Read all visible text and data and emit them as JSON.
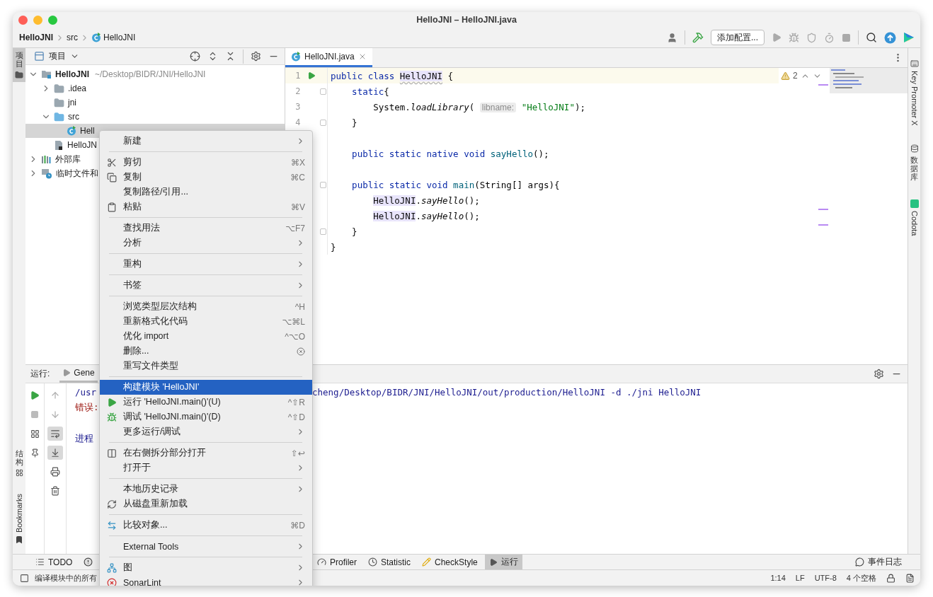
{
  "window": {
    "title": "HelloJNI – HelloJNI.java"
  },
  "breadcrumb": [
    {
      "label": "HelloJNI",
      "kind": "project"
    },
    {
      "label": "src",
      "kind": "folder"
    },
    {
      "label": "HelloJNI",
      "kind": "class"
    }
  ],
  "toolbar": {
    "config_button": "添加配置..."
  },
  "left_stripe": {
    "top": [
      {
        "label": "项目",
        "selected": true
      }
    ],
    "bottom": [
      {
        "label": "结构",
        "kind": "structure",
        "selected": false
      },
      {
        "label": "Bookmarks",
        "kind": "bookmarks",
        "selected": false
      }
    ]
  },
  "project_panel": {
    "title": "项目",
    "tree": [
      {
        "label": "HelloJNI",
        "path": "~/Desktop/BIDR/JNI/HelloJNI",
        "kind": "module",
        "expanded": true,
        "selected": false,
        "children": [
          {
            "label": ".idea",
            "kind": "folder",
            "expanded": false,
            "selected": false
          },
          {
            "label": "jni",
            "kind": "folder",
            "selected": false
          },
          {
            "label": "src",
            "kind": "source-folder",
            "expanded": true,
            "selected": false,
            "children": [
              {
                "label": "Hell",
                "kind": "class",
                "selected": true
              }
            ]
          },
          {
            "label": "HelloJN",
            "kind": "module-file",
            "selected": false
          }
        ]
      },
      {
        "label": "外部库",
        "kind": "library",
        "expanded": false,
        "selected": false
      },
      {
        "label": "临时文件和",
        "kind": "scratch",
        "expanded": false,
        "selected": false
      }
    ]
  },
  "editor": {
    "tabs": [
      {
        "label": "HelloJNI.java",
        "selected": true
      }
    ],
    "warnings": "2",
    "lines": [
      {
        "number": "1",
        "current": true,
        "run_marker": true,
        "fold": false,
        "tokens": [
          {
            "kind": "kw",
            "text": "public class "
          },
          {
            "kind": "ref-decl",
            "text": "HelloJNI"
          },
          {
            "kind": "plain",
            "text": " {"
          }
        ]
      },
      {
        "number": "2",
        "current": false,
        "run_marker": false,
        "fold": true,
        "tokens": [
          {
            "kind": "kw",
            "text": "    static"
          },
          {
            "kind": "plain",
            "text": "{"
          }
        ]
      },
      {
        "number": "3",
        "current": false,
        "run_marker": false,
        "fold": false,
        "tokens": [
          {
            "kind": "plain",
            "text": "        System."
          },
          {
            "kind": "italic",
            "text": "loadLibrary"
          },
          {
            "kind": "plain",
            "text": "( "
          },
          {
            "kind": "hint",
            "text": "libname:"
          },
          {
            "kind": "string",
            "text": " \"HelloJNI\""
          },
          {
            "kind": "plain",
            "text": ");"
          }
        ]
      },
      {
        "number": "4",
        "current": false,
        "run_marker": false,
        "fold": true,
        "tokens": [
          {
            "kind": "plain",
            "text": "    }"
          }
        ]
      },
      {
        "current": false,
        "run_marker": false,
        "fold": false
      },
      {
        "current": false,
        "run_marker": false,
        "fold": false,
        "tokens": [
          {
            "kind": "kw",
            "text": "    public static native void "
          },
          {
            "kind": "method",
            "text": "sayHello"
          },
          {
            "kind": "plain",
            "text": "();"
          }
        ]
      },
      {
        "current": false,
        "run_marker": false,
        "fold": false
      },
      {
        "current": false,
        "run_marker": false,
        "fold": true,
        "tokens": [
          {
            "kind": "kw",
            "text": "    public static void "
          },
          {
            "kind": "method",
            "text": "main"
          },
          {
            "kind": "plain",
            "text": "(String[] args){"
          }
        ]
      },
      {
        "current": false,
        "run_marker": false,
        "fold": false,
        "tokens": [
          {
            "kind": "ref",
            "text": "        HelloJNI"
          },
          {
            "kind": "plain",
            "text": "."
          },
          {
            "kind": "italic",
            "text": "sayHello"
          },
          {
            "kind": "plain",
            "text": "();"
          }
        ]
      },
      {
        "current": false,
        "run_marker": false,
        "fold": false,
        "tokens": [
          {
            "kind": "ref",
            "text": "        HelloJNI"
          },
          {
            "kind": "plain",
            "text": "."
          },
          {
            "kind": "italic",
            "text": "sayHello"
          },
          {
            "kind": "plain",
            "text": "();"
          }
        ]
      },
      {
        "current": false,
        "run_marker": false,
        "fold": true,
        "tokens": [
          {
            "kind": "plain",
            "text": "    }"
          }
        ]
      },
      {
        "current": false,
        "run_marker": false,
        "fold": false,
        "tokens": [
          {
            "kind": "plain",
            "text": "}"
          }
        ]
      }
    ]
  },
  "right_stripe": [
    {
      "label": "Key Promoter X",
      "kind": "key"
    },
    {
      "label": "数据库",
      "kind": "database"
    },
    {
      "label": "Codota",
      "kind": "codota"
    }
  ],
  "run_panel": {
    "title": "运行:",
    "tabs": [
      {
        "label": "Gene",
        "selected": true
      }
    ],
    "soft_wrap_on": true,
    "scroll_to_end_on": true,
    "lines": [
      {
        "kind": "command",
        "text": "/usr",
        "rest": "cheng/Desktop/BIDR/JNI/HelloJNI/out/production/HelloJNI -d ./jni HelloJNI"
      },
      {
        "kind": "error",
        "text": "错误:"
      },
      {
        "kind": "info",
        "text": "进程"
      }
    ]
  },
  "menu": [
    {
      "kind": "plain",
      "label": "新建",
      "submenu": true,
      "selected": false
    },
    {
      "kind": "separator"
    },
    {
      "kind": "cut",
      "label": "剪切",
      "shortcut": "⌘X",
      "selected": false
    },
    {
      "kind": "copy",
      "label": "复制",
      "shortcut": "⌘C",
      "selected": false
    },
    {
      "kind": "plain",
      "label": "复制路径/引用...",
      "selected": false
    },
    {
      "kind": "paste",
      "label": "粘贴",
      "shortcut": "⌘V",
      "selected": false
    },
    {
      "kind": "separator"
    },
    {
      "kind": "plain",
      "label": "查找用法",
      "shortcut": "⌥F7",
      "selected": false
    },
    {
      "kind": "plain",
      "label": "分析",
      "submenu": true,
      "selected": false
    },
    {
      "kind": "separator"
    },
    {
      "kind": "plain",
      "label": "重构",
      "submenu": true,
      "selected": false
    },
    {
      "kind": "separator"
    },
    {
      "kind": "plain",
      "label": "书签",
      "submenu": true,
      "selected": false
    },
    {
      "kind": "separator"
    },
    {
      "kind": "plain",
      "label": "浏览类型层次结构",
      "shortcut": "^H",
      "selected": false
    },
    {
      "kind": "plain",
      "label": "重新格式化代码",
      "shortcut": "⌥⌘L",
      "selected": false
    },
    {
      "kind": "plain",
      "label": "优化 import",
      "shortcut": "^⌥O",
      "selected": false
    },
    {
      "kind": "delete",
      "label": "删除...",
      "selected": false
    },
    {
      "kind": "plain",
      "label": "重写文件类型",
      "selected": false
    },
    {
      "kind": "separator"
    },
    {
      "kind": "plain",
      "label": "构建模块 'HelloJNI'",
      "selected": true
    },
    {
      "kind": "run",
      "label": "运行 'HelloJNI.main()'(U)",
      "shortcut": "^⇧R",
      "selected": false
    },
    {
      "kind": "debug",
      "label": "调试 'HelloJNI.main()'(D)",
      "shortcut": "^⇧D",
      "selected": false
    },
    {
      "kind": "plain",
      "label": "更多运行/调试",
      "submenu": true,
      "selected": false
    },
    {
      "kind": "separator"
    },
    {
      "kind": "split",
      "label": "在右侧拆分部分打开",
      "shortcut": "⇧↩",
      "selected": false
    },
    {
      "kind": "plain",
      "label": "打开于",
      "submenu": true,
      "selected": false
    },
    {
      "kind": "separator"
    },
    {
      "kind": "plain",
      "label": "本地历史记录",
      "submenu": true,
      "selected": false
    },
    {
      "kind": "reload",
      "label": "从磁盘重新加载",
      "selected": false
    },
    {
      "kind": "separator"
    },
    {
      "kind": "compare",
      "label": "比较对象...",
      "shortcut": "⌘D",
      "selected": false
    },
    {
      "kind": "separator"
    },
    {
      "kind": "plain",
      "label": "External Tools",
      "submenu": true,
      "selected": false
    },
    {
      "kind": "separator"
    },
    {
      "kind": "diagram",
      "label": "图",
      "submenu": true,
      "selected": false
    },
    {
      "kind": "sonar",
      "label": "SonarLint",
      "submenu": true,
      "selected": false
    }
  ],
  "tool_tabs": {
    "left": [
      {
        "label": "TODO",
        "kind": "todo",
        "selected": false
      },
      {
        "kind": "problems",
        "selected": false
      }
    ],
    "right": [
      {
        "label": "Profiler",
        "kind": "profiler",
        "selected": false
      },
      {
        "label": "Statistic",
        "kind": "statistic",
        "selected": false
      },
      {
        "label": "CheckStyle",
        "kind": "checkstyle",
        "selected": false
      },
      {
        "label": "运行",
        "kind": "run",
        "selected": true
      }
    ],
    "event_log": "事件日志"
  },
  "status_bar": {
    "message": "编译模块中的所有",
    "items": [
      "1:14",
      "LF",
      "UTF-8",
      "4 个空格"
    ]
  }
}
